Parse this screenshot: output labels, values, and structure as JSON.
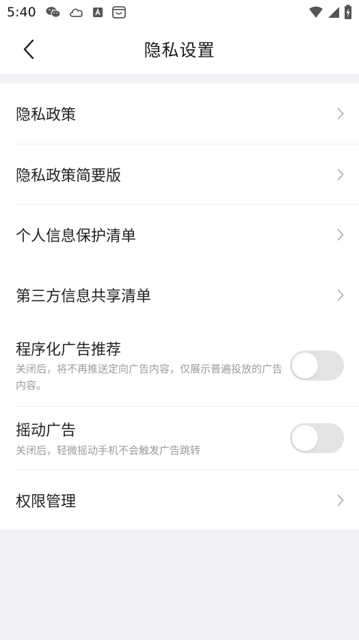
{
  "status_bar": {
    "time": "5:40",
    "left_icons": [
      "wechat-icon",
      "cloud-icon",
      "font-a-icon",
      "shopping-bag-icon"
    ],
    "right_icons": [
      "wifi-icon",
      "signal-icon",
      "battery-charging-icon"
    ]
  },
  "header": {
    "title": "隐私设置",
    "back_icon": "chevron-left-icon"
  },
  "menu": {
    "privacy_policy": "隐私政策",
    "privacy_policy_brief": "隐私政策简要版",
    "personal_info_list": "个人信息保护清单",
    "third_party_list": "第三方信息共享清单",
    "permissions": "权限管理"
  },
  "toggles": {
    "programmatic_ads": {
      "title": "程序化广告推荐",
      "desc": "关闭后，将不再推送定向广告内容，仅展示普遍投放的广告内容。",
      "on": false
    },
    "shake_ads": {
      "title": "摇动广告",
      "desc": "关闭后，轻微摇动手机不会触发广告跳转",
      "on": false
    }
  },
  "colors": {
    "background": "#f1f2f6",
    "card": "#ffffff",
    "switch_off": "#e3e3e3",
    "secondary_text": "#9a9a9a"
  }
}
